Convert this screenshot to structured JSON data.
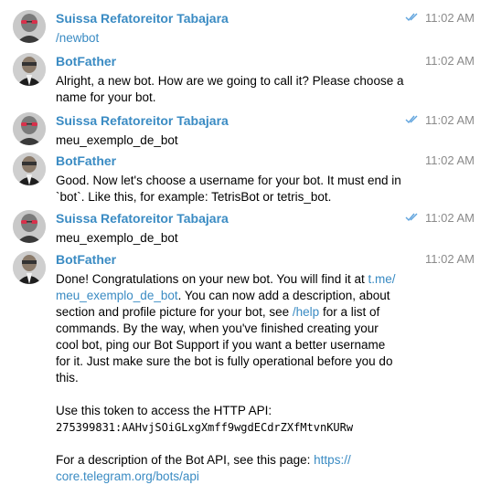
{
  "colors": {
    "sender": "#3a8bc3",
    "link": "#3a8bc3",
    "time": "#8a8a8a",
    "read_checks": "#5fa3dd"
  },
  "messages": [
    {
      "sender": "Suissa Refatoreitor Tabajara",
      "time": "11:02 AM",
      "read_icon": "double-check-icon",
      "text": "/newbot"
    },
    {
      "sender": "BotFather",
      "time": "11:02 AM",
      "text_line1": "Alright, a new bot. How are we going to call it? Please choose a",
      "text_line2": "name for your bot."
    },
    {
      "sender": "Suissa Refatoreitor Tabajara",
      "time": "11:02 AM",
      "read_icon": "double-check-icon",
      "text": "meu_exemplo_de_bot"
    },
    {
      "sender": "BotFather",
      "time": "11:02 AM",
      "text_line1": "Good. Now let's choose a username for your bot. It must end in",
      "text_line2": "`bot`. Like this, for example: TetrisBot or tetris_bot."
    },
    {
      "sender": "Suissa Refatoreitor Tabajara",
      "time": "11:02 AM",
      "read_icon": "double-check-icon",
      "text": "meu_exemplo_de_bot"
    },
    {
      "sender": "BotFather",
      "time": "11:02 AM",
      "l1_pre": "Done! Congratulations on your new bot. You will find it at ",
      "l1_link": "t.me/",
      "l2_link": "meu_exemplo_de_bot",
      "l2_post": ". You can now add a description, about",
      "l3": "section and profile picture for your bot, see ",
      "l3_link": "/help",
      "l3_post": " for a list of",
      "l4": "commands. By the way, when you've finished creating your",
      "l5": "cool bot, ping our Bot Support if you want a better username",
      "l6": "for it. Just make sure the bot is fully operational before you do",
      "l7": "this.",
      "token_intro": "Use this token to access the HTTP API:",
      "token": "275399831:AAHvjSOiGLxgXmff9wgdECdrZXfMtvnKURw",
      "api_pre": "For a description of the Bot API, see this page: ",
      "api_link1": "https://",
      "api_link2": "core.telegram.org/bots/api"
    }
  ]
}
